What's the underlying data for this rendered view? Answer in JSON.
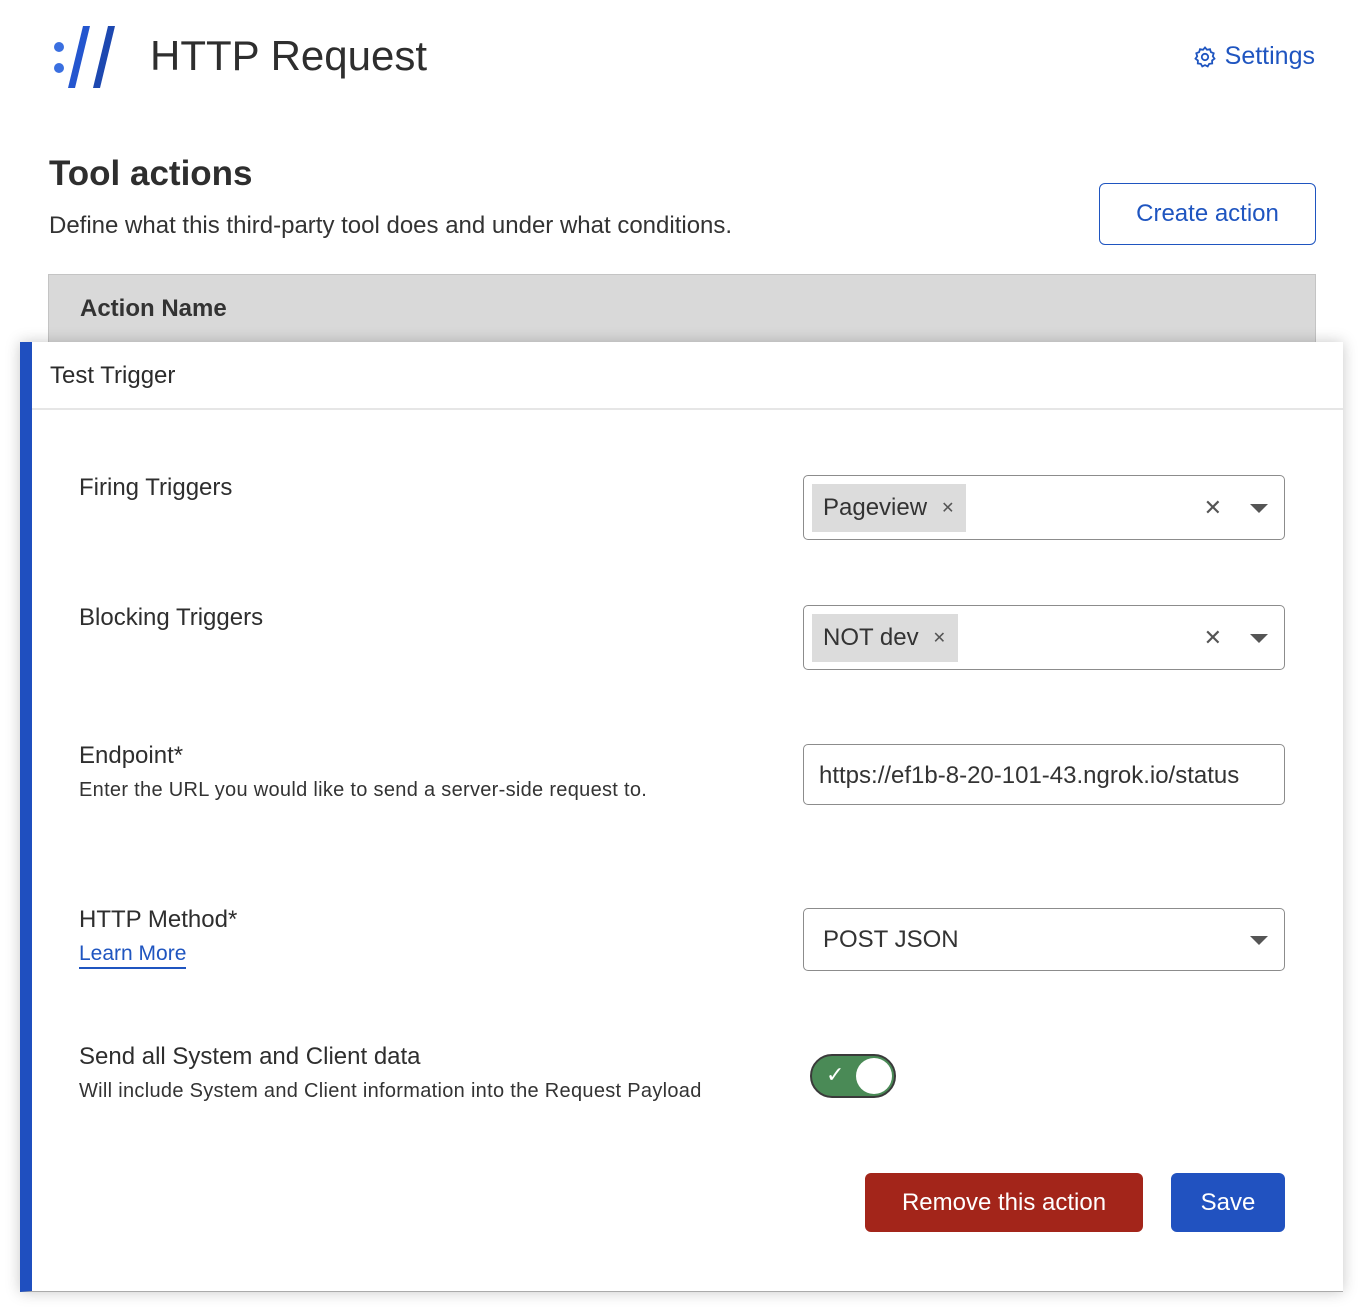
{
  "header": {
    "title": "HTTP Request",
    "settings_label": "Settings",
    "logo": "colon-double-slash-logo"
  },
  "section": {
    "title": "Tool actions",
    "subtitle": "Define what this third-party tool does and under what conditions.",
    "create_button": "Create action"
  },
  "table": {
    "column_header": "Action Name"
  },
  "action": {
    "name": "Test Trigger",
    "firing_triggers": {
      "label": "Firing Triggers",
      "chips": [
        "Pageview"
      ]
    },
    "blocking_triggers": {
      "label": "Blocking Triggers",
      "chips": [
        "NOT dev"
      ]
    },
    "endpoint": {
      "label": "Endpoint*",
      "description": "Enter the URL you would like to send a server-side request to.",
      "value": "https://ef1b-8-20-101-43.ngrok.io/status"
    },
    "http_method": {
      "label": "HTTP Method*",
      "link": "Learn More",
      "value": "POST JSON"
    },
    "send_data": {
      "label": "Send all System and Client data",
      "description": "Will include System and Client information into the Request Payload",
      "enabled": true
    },
    "remove_button": "Remove this action",
    "save_button": "Save"
  },
  "colors": {
    "accent": "#1f55c0",
    "danger": "#a3251a",
    "toggle_on": "#4a8a56"
  }
}
